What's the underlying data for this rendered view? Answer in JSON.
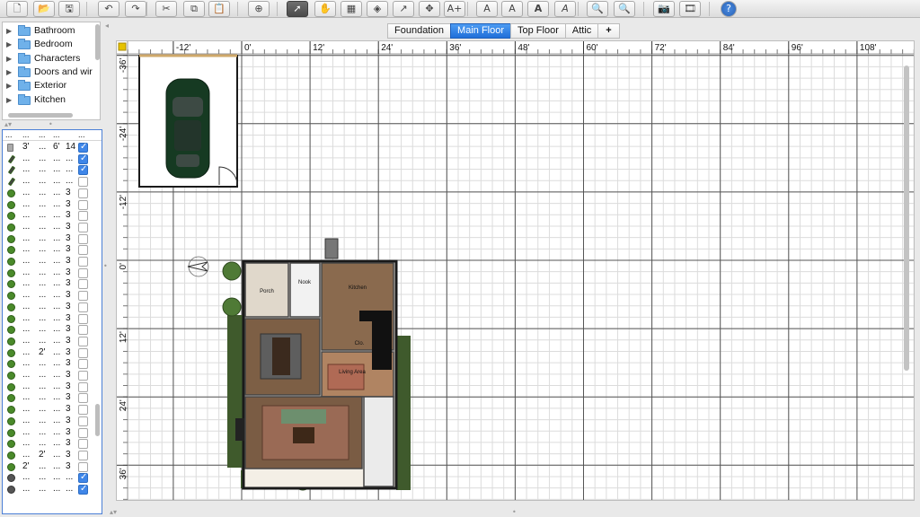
{
  "toolbar": {
    "buttons": [
      {
        "name": "new-home-icon",
        "glyph": "🗋"
      },
      {
        "name": "open-icon",
        "glyph": "📂"
      },
      {
        "name": "save-icon",
        "glyph": "🖫"
      },
      {
        "name": "undo-icon",
        "glyph": "↶"
      },
      {
        "name": "redo-icon",
        "glyph": "↷"
      },
      {
        "name": "cut-icon",
        "glyph": "✂"
      },
      {
        "name": "copy-icon",
        "glyph": "⧉"
      },
      {
        "name": "paste-icon",
        "glyph": "📋"
      },
      {
        "name": "add-furniture-icon",
        "glyph": "⊕"
      },
      {
        "name": "select-mode-icon",
        "glyph": "➚"
      },
      {
        "name": "pan-mode-icon",
        "glyph": "✋"
      },
      {
        "name": "create-walls-icon",
        "glyph": "▦"
      },
      {
        "name": "create-rooms-icon",
        "glyph": "◈"
      },
      {
        "name": "create-polylines-icon",
        "glyph": "↗"
      },
      {
        "name": "create-dimensions-icon",
        "glyph": "✥"
      },
      {
        "name": "add-text-icon",
        "glyph": "A+"
      },
      {
        "name": "increase-text-size-icon",
        "glyph": "A"
      },
      {
        "name": "decrease-text-size-icon",
        "glyph": "A"
      },
      {
        "name": "bold-text-icon",
        "glyph": "A"
      },
      {
        "name": "italic-text-icon",
        "glyph": "A"
      },
      {
        "name": "zoom-in-icon",
        "glyph": "🔍"
      },
      {
        "name": "zoom-out-icon",
        "glyph": "🔍"
      },
      {
        "name": "create-photo-icon",
        "glyph": "📷"
      },
      {
        "name": "create-video-icon",
        "glyph": "🎞"
      },
      {
        "name": "help-icon",
        "glyph": "?"
      }
    ],
    "active": "select-mode-icon"
  },
  "catalog": {
    "categories": [
      "Bathroom",
      "Bedroom",
      "Characters",
      "Doors and wir",
      "Exterior",
      "Kitchen"
    ]
  },
  "furniture": {
    "header": [
      "...",
      "...",
      "...",
      "...",
      "..."
    ],
    "rows": [
      {
        "icon": "door",
        "c1": "3'",
        "c2": "...",
        "c3": "6'",
        "c4": "14",
        "visible": true
      },
      {
        "icon": "lamp",
        "c1": "...",
        "c2": "...",
        "c3": "...",
        "c4": "...",
        "visible": true
      },
      {
        "icon": "lamp",
        "c1": "...",
        "c2": "...",
        "c3": "...",
        "c4": "...",
        "visible": true
      },
      {
        "icon": "lamp",
        "c1": "...",
        "c2": "...",
        "c3": "...",
        "c4": "...",
        "visible": false
      },
      {
        "icon": "plant",
        "c1": "...",
        "c2": "...",
        "c3": "...",
        "c4": "3",
        "visible": false
      },
      {
        "icon": "plant",
        "c1": "...",
        "c2": "...",
        "c3": "...",
        "c4": "3",
        "visible": false
      },
      {
        "icon": "plant",
        "c1": "...",
        "c2": "...",
        "c3": "...",
        "c4": "3",
        "visible": false
      },
      {
        "icon": "plant",
        "c1": "...",
        "c2": "...",
        "c3": "...",
        "c4": "3",
        "visible": false
      },
      {
        "icon": "plant",
        "c1": "...",
        "c2": "...",
        "c3": "...",
        "c4": "3",
        "visible": false
      },
      {
        "icon": "plant",
        "c1": "...",
        "c2": "...",
        "c3": "...",
        "c4": "3",
        "visible": false
      },
      {
        "icon": "plant",
        "c1": "...",
        "c2": "...",
        "c3": "...",
        "c4": "3",
        "visible": false
      },
      {
        "icon": "plant",
        "c1": "...",
        "c2": "...",
        "c3": "...",
        "c4": "3",
        "visible": false
      },
      {
        "icon": "plant",
        "c1": "...",
        "c2": "...",
        "c3": "...",
        "c4": "3",
        "visible": false
      },
      {
        "icon": "plant",
        "c1": "...",
        "c2": "...",
        "c3": "...",
        "c4": "3",
        "visible": false
      },
      {
        "icon": "plant",
        "c1": "...",
        "c2": "...",
        "c3": "...",
        "c4": "3",
        "visible": false
      },
      {
        "icon": "plant",
        "c1": "...",
        "c2": "...",
        "c3": "...",
        "c4": "3",
        "visible": false
      },
      {
        "icon": "plant",
        "c1": "...",
        "c2": "...",
        "c3": "...",
        "c4": "3",
        "visible": false
      },
      {
        "icon": "plant",
        "c1": "...",
        "c2": "...",
        "c3": "...",
        "c4": "3",
        "visible": false
      },
      {
        "icon": "plant",
        "c1": "...",
        "c2": "2'",
        "c3": "...",
        "c4": "3",
        "visible": false
      },
      {
        "icon": "plant",
        "c1": "...",
        "c2": "...",
        "c3": "...",
        "c4": "3",
        "visible": false
      },
      {
        "icon": "plant",
        "c1": "...",
        "c2": "...",
        "c3": "...",
        "c4": "3",
        "visible": false
      },
      {
        "icon": "plant",
        "c1": "...",
        "c2": "...",
        "c3": "...",
        "c4": "3",
        "visible": false
      },
      {
        "icon": "plant",
        "c1": "...",
        "c2": "...",
        "c3": "...",
        "c4": "3",
        "visible": false
      },
      {
        "icon": "plant",
        "c1": "...",
        "c2": "...",
        "c3": "...",
        "c4": "3",
        "visible": false
      },
      {
        "icon": "plant",
        "c1": "...",
        "c2": "...",
        "c3": "...",
        "c4": "3",
        "visible": false
      },
      {
        "icon": "plant",
        "c1": "...",
        "c2": "...",
        "c3": "...",
        "c4": "3",
        "visible": false
      },
      {
        "icon": "plant",
        "c1": "...",
        "c2": "...",
        "c3": "...",
        "c4": "3",
        "visible": false
      },
      {
        "icon": "plant",
        "c1": "...",
        "c2": "2'",
        "c3": "...",
        "c4": "3",
        "visible": false
      },
      {
        "icon": "plant",
        "c1": "2'",
        "c2": "...",
        "c3": "...",
        "c4": "3",
        "visible": false
      },
      {
        "icon": "dark",
        "c1": "...",
        "c2": "...",
        "c3": "...",
        "c4": "...",
        "visible": true
      },
      {
        "icon": "dark",
        "c1": "...",
        "c2": "...",
        "c3": "...",
        "c4": "...",
        "visible": true
      }
    ]
  },
  "tabs": [
    "Foundation",
    "Main Floor",
    "Top Floor",
    "Attic"
  ],
  "tabs_selected": "Main Floor",
  "add_level_glyph": "+",
  "plan": {
    "top_ruler": [
      "-12'",
      "0'",
      "12'",
      "24'",
      "36'",
      "48'",
      "60'",
      "72'",
      "84'",
      "96'",
      "108'"
    ],
    "left_ruler": [
      "-36'",
      "-24'",
      "-12'",
      "0'",
      "12'",
      "24'",
      "36'"
    ],
    "room_labels": [
      "Porch",
      "Nook",
      "Kitchen",
      "Clo.",
      "Living Area"
    ]
  },
  "colors": {
    "accent": "#1f6fd9",
    "grid_minor": "#dcdcdc",
    "grid_major": "#555555",
    "hedge": "#3f5a2c",
    "wall": "#1a1a1a"
  }
}
